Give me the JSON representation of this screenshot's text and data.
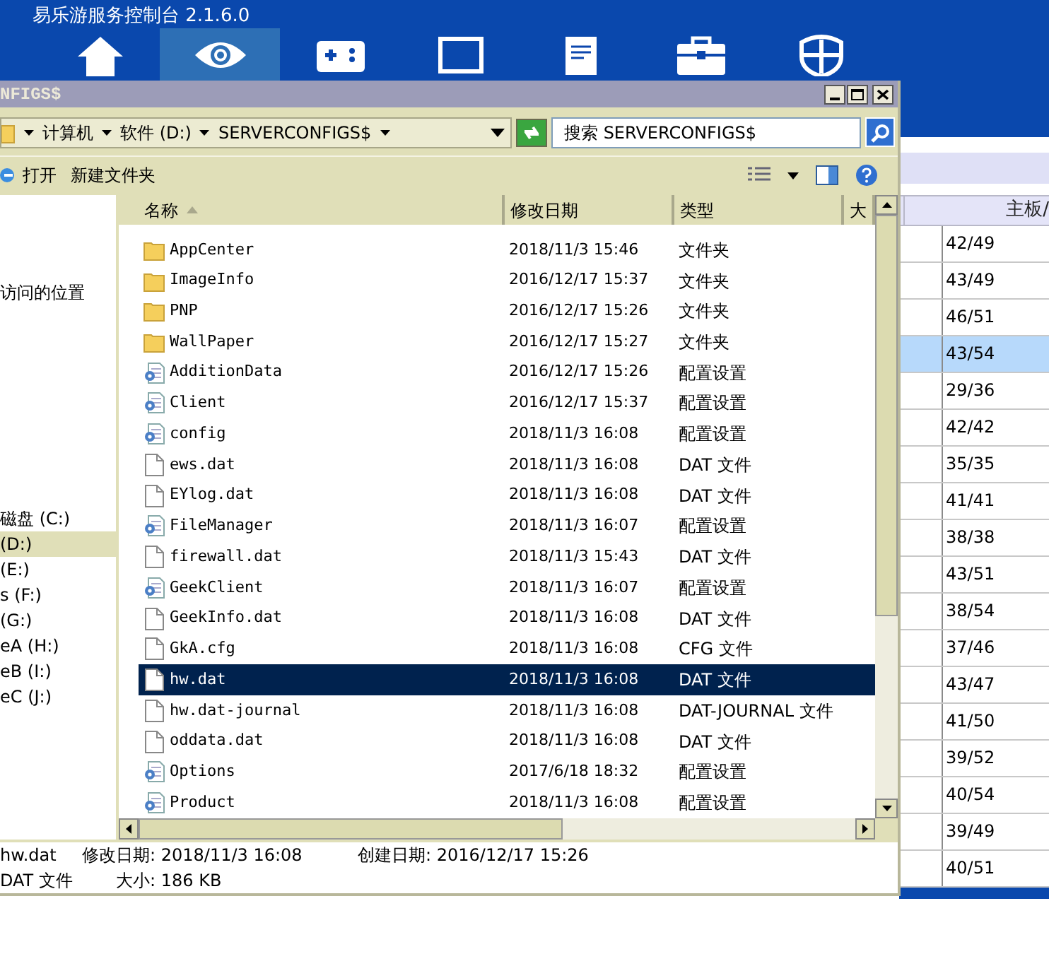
{
  "app": {
    "title": "易乐游服务控制台 2.1.6.0",
    "toolbar_icons": [
      {
        "kind": "home",
        "selected": false
      },
      {
        "kind": "eye",
        "selected": true
      },
      {
        "kind": "gamepad",
        "selected": false
      },
      {
        "kind": "monitor",
        "selected": false
      },
      {
        "kind": "document",
        "selected": false
      },
      {
        "kind": "toolbox",
        "selected": false
      },
      {
        "kind": "shield",
        "selected": false
      }
    ]
  },
  "table": {
    "column": "主板/",
    "rows": [
      {
        "value": "42/49",
        "selected": false
      },
      {
        "value": "43/49",
        "selected": false
      },
      {
        "value": "46/51",
        "selected": false
      },
      {
        "value": "43/54",
        "selected": true
      },
      {
        "value": "29/36",
        "selected": false
      },
      {
        "value": "42/42",
        "selected": false
      },
      {
        "value": "35/35",
        "selected": false
      },
      {
        "value": "41/41",
        "selected": false
      },
      {
        "value": "38/38",
        "selected": false
      },
      {
        "value": "43/51",
        "selected": false
      },
      {
        "value": "38/54",
        "selected": false
      },
      {
        "value": "37/46",
        "selected": false
      },
      {
        "value": "43/47",
        "selected": false
      },
      {
        "value": "41/50",
        "selected": false
      },
      {
        "value": "39/52",
        "selected": false
      },
      {
        "value": "40/54",
        "selected": false
      },
      {
        "value": "39/49",
        "selected": false
      },
      {
        "value": "40/51",
        "selected": false
      }
    ]
  },
  "explorer": {
    "title": "NFIGS$",
    "breadcrumb": [
      "计算机",
      "软件 (D:)",
      "SERVERCONFIGS$"
    ],
    "search_placeholder": "搜索 SERVERCONFIGS$",
    "toolbar": [
      "打开",
      "新建文件夹"
    ],
    "nav_items": [
      {
        "label": "访问的位置",
        "selected": false
      },
      {
        "label": "磁盘 (C:)",
        "selected": false
      },
      {
        "label": "(D:)",
        "selected": true
      },
      {
        "label": "(E:)",
        "selected": false
      },
      {
        "label": "s (F:)",
        "selected": false
      },
      {
        "label": "(G:)",
        "selected": false
      },
      {
        "label": "eA (H:)",
        "selected": false
      },
      {
        "label": "eB (I:)",
        "selected": false
      },
      {
        "label": "eC (J:)",
        "selected": false
      }
    ],
    "columns": [
      "名称",
      "修改日期",
      "类型",
      "大"
    ],
    "files": [
      {
        "name": "AppCenter",
        "date": "2018/11/3 15:46",
        "type": "文件夹",
        "kind": "folder",
        "selected": false
      },
      {
        "name": "ImageInfo",
        "date": "2016/12/17 15:37",
        "type": "文件夹",
        "kind": "folder",
        "selected": false
      },
      {
        "name": "PNP",
        "date": "2016/12/17 15:26",
        "type": "文件夹",
        "kind": "folder",
        "selected": false
      },
      {
        "name": "WallPaper",
        "date": "2016/12/17 15:27",
        "type": "文件夹",
        "kind": "folder",
        "selected": false
      },
      {
        "name": "AdditionData",
        "date": "2016/12/17 15:26",
        "type": "配置设置",
        "kind": "config",
        "selected": false
      },
      {
        "name": "Client",
        "date": "2016/12/17 15:37",
        "type": "配置设置",
        "kind": "config",
        "selected": false
      },
      {
        "name": "config",
        "date": "2018/11/3 16:08",
        "type": "配置设置",
        "kind": "config",
        "selected": false
      },
      {
        "name": "ews.dat",
        "date": "2018/11/3 16:08",
        "type": "DAT 文件",
        "kind": "file",
        "selected": false
      },
      {
        "name": "EYlog.dat",
        "date": "2018/11/3 16:08",
        "type": "DAT 文件",
        "kind": "file",
        "selected": false
      },
      {
        "name": "FileManager",
        "date": "2018/11/3 16:07",
        "type": "配置设置",
        "kind": "config",
        "selected": false
      },
      {
        "name": "firewall.dat",
        "date": "2018/11/3 15:43",
        "type": "DAT 文件",
        "kind": "file",
        "selected": false
      },
      {
        "name": "GeekClient",
        "date": "2018/11/3 16:07",
        "type": "配置设置",
        "kind": "config",
        "selected": false
      },
      {
        "name": "GeekInfo.dat",
        "date": "2018/11/3 16:08",
        "type": "DAT 文件",
        "kind": "file",
        "selected": false
      },
      {
        "name": "GkA.cfg",
        "date": "2018/11/3 16:08",
        "type": "CFG 文件",
        "kind": "file",
        "selected": false
      },
      {
        "name": "hw.dat",
        "date": "2018/11/3 16:08",
        "type": "DAT 文件",
        "kind": "file",
        "selected": true
      },
      {
        "name": "hw.dat-journal",
        "date": "2018/11/3 16:08",
        "type": "DAT-JOURNAL 文件",
        "kind": "file",
        "selected": false
      },
      {
        "name": "oddata.dat",
        "date": "2018/11/3 16:08",
        "type": "DAT 文件",
        "kind": "file",
        "selected": false
      },
      {
        "name": "Options",
        "date": "2017/6/18 18:32",
        "type": "配置设置",
        "kind": "config",
        "selected": false
      },
      {
        "name": "Product",
        "date": "2018/11/3 16:08",
        "type": "配置设置",
        "kind": "config",
        "selected": false
      }
    ],
    "details": {
      "name": "hw.dat",
      "modified": "修改日期: 2018/11/3 16:08",
      "created": "创建日期: 2016/12/17 15:26",
      "type": "DAT 文件",
      "size": "大小: 186 KB"
    }
  }
}
